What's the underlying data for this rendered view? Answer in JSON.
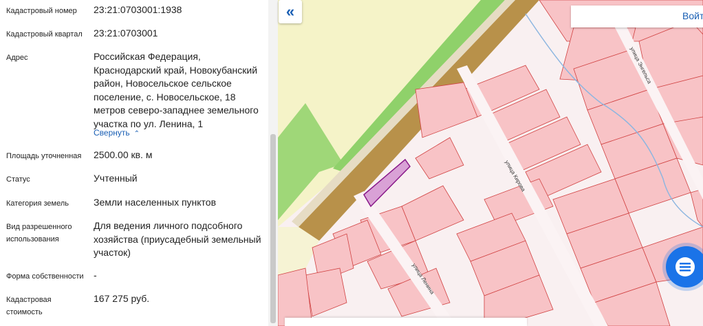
{
  "details": [
    {
      "label": "Кадастровый номер",
      "value": "23:21:0703001:1938"
    },
    {
      "label": "Кадастровый квартал",
      "value": "23:21:0703001"
    },
    {
      "label": "Адрес",
      "value": "Российская Федерация, Краснодарский край, Новокубанский район, Новосельское сельское поселение, с. Новосельское, 18 метров северо-западнее земельного участка по ул. Ленина, 1"
    },
    {
      "label": "Площадь уточненная",
      "value": "2500.00 кв. м"
    },
    {
      "label": "Статус",
      "value": "Учтенный"
    },
    {
      "label": "Категория земель",
      "value": "Земли населенных пунктов"
    },
    {
      "label": "Вид разрешенного использования",
      "value": "Для ведения личного подсобного хозяйства (приусадебный земельный участок)"
    },
    {
      "label": "Форма собственности",
      "value": "-"
    },
    {
      "label": "Кадастровая стоимость",
      "value": "167 275 руб."
    }
  ],
  "collapse_link": "Свернуть",
  "map": {
    "login_label": "Войт",
    "street_lenina": "улица Ленина",
    "street_kirova": "улица Кирова",
    "street_engelsa": "улица Энгельса",
    "collapse_icon": "double-chevron-left-icon",
    "chat_icon": "chat-bubble-icon"
  },
  "colors": {
    "link": "#1a5fb4",
    "parcel_highlight": "#c060c0",
    "parcel_border": "#d04040",
    "road": "#b8914a",
    "green": "#8fd16a"
  }
}
